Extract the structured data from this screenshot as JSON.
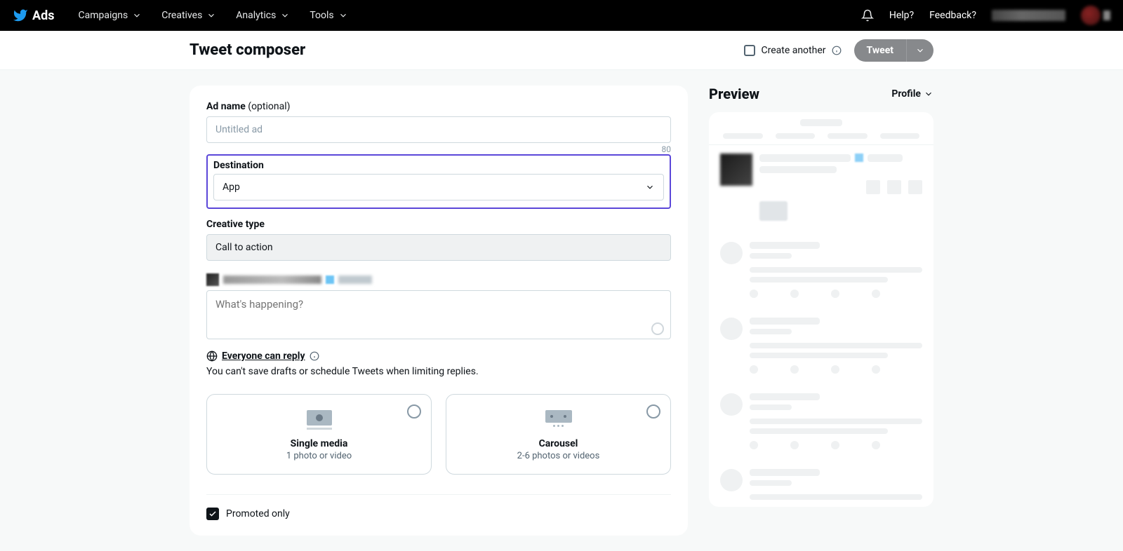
{
  "nav": {
    "logo_text": "Ads",
    "items": [
      "Campaigns",
      "Creatives",
      "Analytics",
      "Tools"
    ],
    "help": "Help?",
    "feedback": "Feedback?"
  },
  "header": {
    "title": "Tweet composer",
    "create_another": "Create another",
    "tweet_button": "Tweet"
  },
  "form": {
    "ad_name_label": "Ad name",
    "ad_name_optional": "(optional)",
    "ad_name_placeholder": "Untitled ad",
    "ad_name_counter": "80",
    "destination_label": "Destination",
    "destination_value": "App",
    "creative_type_label": "Creative type",
    "creative_type_value": "Call to action",
    "tweet_placeholder": "What's happening?",
    "reply_setting": "Everyone can reply",
    "reply_note": "You can't save drafts or schedule Tweets when limiting replies.",
    "media_options": [
      {
        "title": "Single media",
        "sub": "1 photo or video"
      },
      {
        "title": "Carousel",
        "sub": "2-6 photos or videos"
      }
    ],
    "promoted_only": "Promoted only"
  },
  "preview": {
    "title": "Preview",
    "view_mode": "Profile"
  }
}
